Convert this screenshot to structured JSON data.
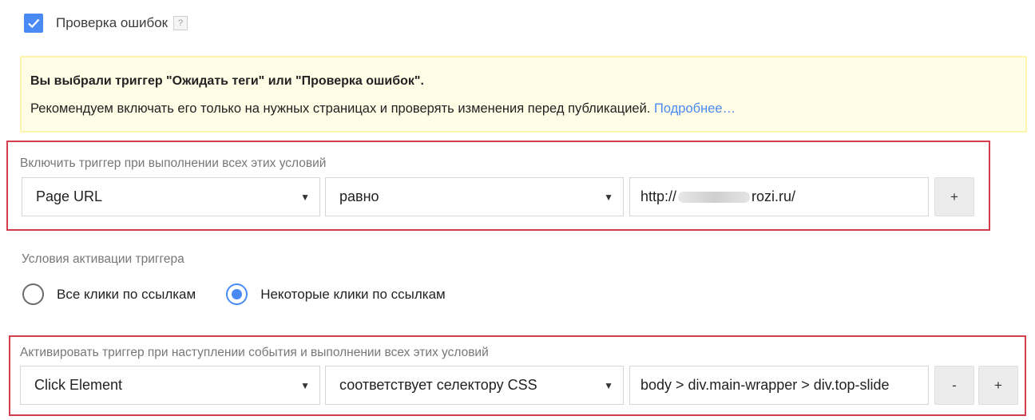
{
  "error_check": {
    "checked": true,
    "label": "Проверка ошибок",
    "help": "?"
  },
  "notice": {
    "title": "Вы выбрали триггер \"Ожидать теги\" или \"Проверка ошибок\".",
    "text": "Рекомендуем включать его только на нужных страницах и проверять изменения перед публикацией.",
    "link": "Подробнее…"
  },
  "enable_conditions": {
    "label": "Включить триггер при выполнении всех этих условий",
    "variable": "Page URL",
    "operator": "равно",
    "value_prefix": "http://",
    "value_suffix": "rozi.ru/",
    "add_button": "+"
  },
  "activation": {
    "label": "Условия активации триггера",
    "options": [
      {
        "label": "Все клики по ссылкам",
        "selected": false
      },
      {
        "label": "Некоторые клики по ссылкам",
        "selected": true
      }
    ]
  },
  "event_conditions": {
    "label": "Активировать триггер при наступлении события и выполнении всех этих условий",
    "variable": "Click Element",
    "operator": "соответствует селектору CSS",
    "value": "body > div.main-wrapper > div.top-slide",
    "remove_button": "-",
    "add_button": "+"
  },
  "colors": {
    "accent": "#4a8af4",
    "highlight_border": "#d23e4b",
    "notice_bg": "#fffde6"
  }
}
